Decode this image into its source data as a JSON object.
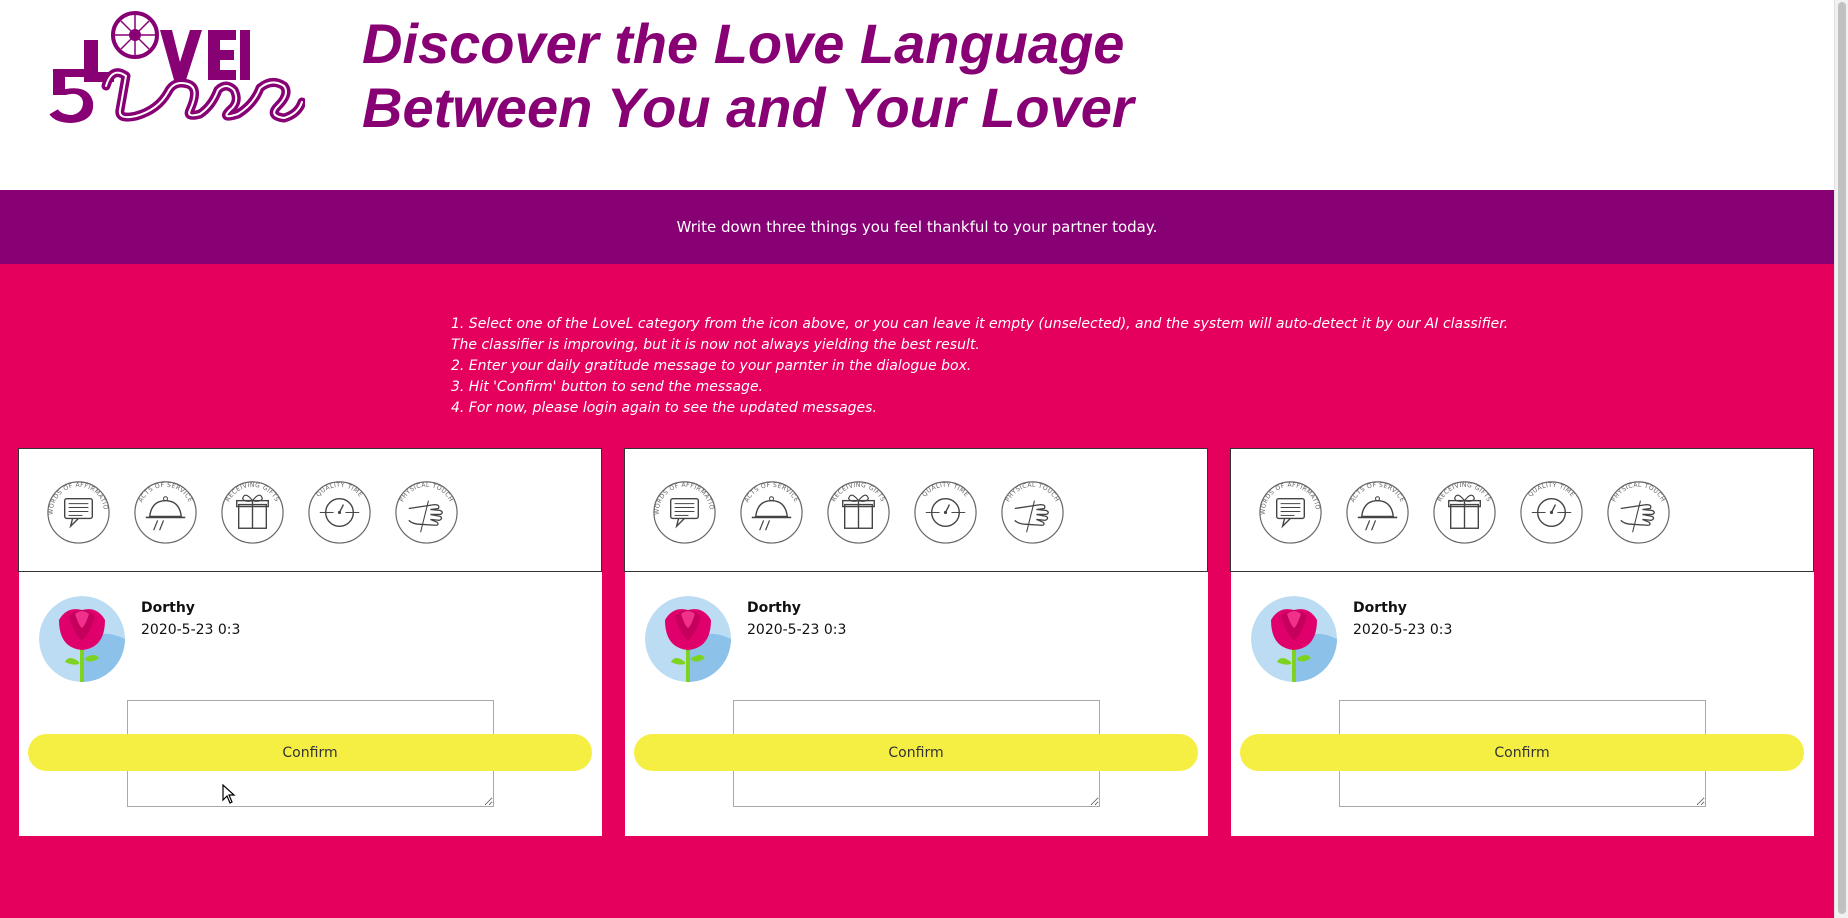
{
  "header": {
    "headline_line1": "Discover the Love Language",
    "headline_line2": "Between You and Your Lover"
  },
  "banner": {
    "text": "Write down three things you feel thankful to your partner today."
  },
  "instructions": [
    "1. Select one of the LoveL category from the icon above, or you can leave it empty (unselected), and the system will auto-detect it by our AI classifier.",
    "The classifier is improving, but it is now not always yielding the best result.",
    "2. Enter your daily gratitude message to your parnter in the dialogue box.",
    "3. Hit 'Confirm' button to send the message.",
    "4. For now, please login again to see the updated messages."
  ],
  "categories": [
    {
      "label": "WORDS OF AFFIRMATION",
      "icon": "speech-bubble-icon"
    },
    {
      "label": "ACTS OF SERVICE",
      "icon": "serving-cloche-icon"
    },
    {
      "label": "RECEIVING GIFTS",
      "icon": "gift-box-icon"
    },
    {
      "label": "QUALITY TIME",
      "icon": "clock-icon"
    },
    {
      "label": "PHYSICAL TOUCH",
      "icon": "hand-icon"
    }
  ],
  "cards": [
    {
      "user": "Dorthy",
      "date": "2020-5-23 0:3",
      "message": "",
      "confirm": "Confirm"
    },
    {
      "user": "Dorthy",
      "date": "2020-5-23 0:3",
      "message": "",
      "confirm": "Confirm"
    },
    {
      "user": "Dorthy",
      "date": "2020-5-23 0:3",
      "message": "",
      "confirm": "Confirm"
    }
  ],
  "colors": {
    "brand_purple": "#870074",
    "main_pink": "#e6005e",
    "confirm_yellow": "#f5ef44"
  }
}
